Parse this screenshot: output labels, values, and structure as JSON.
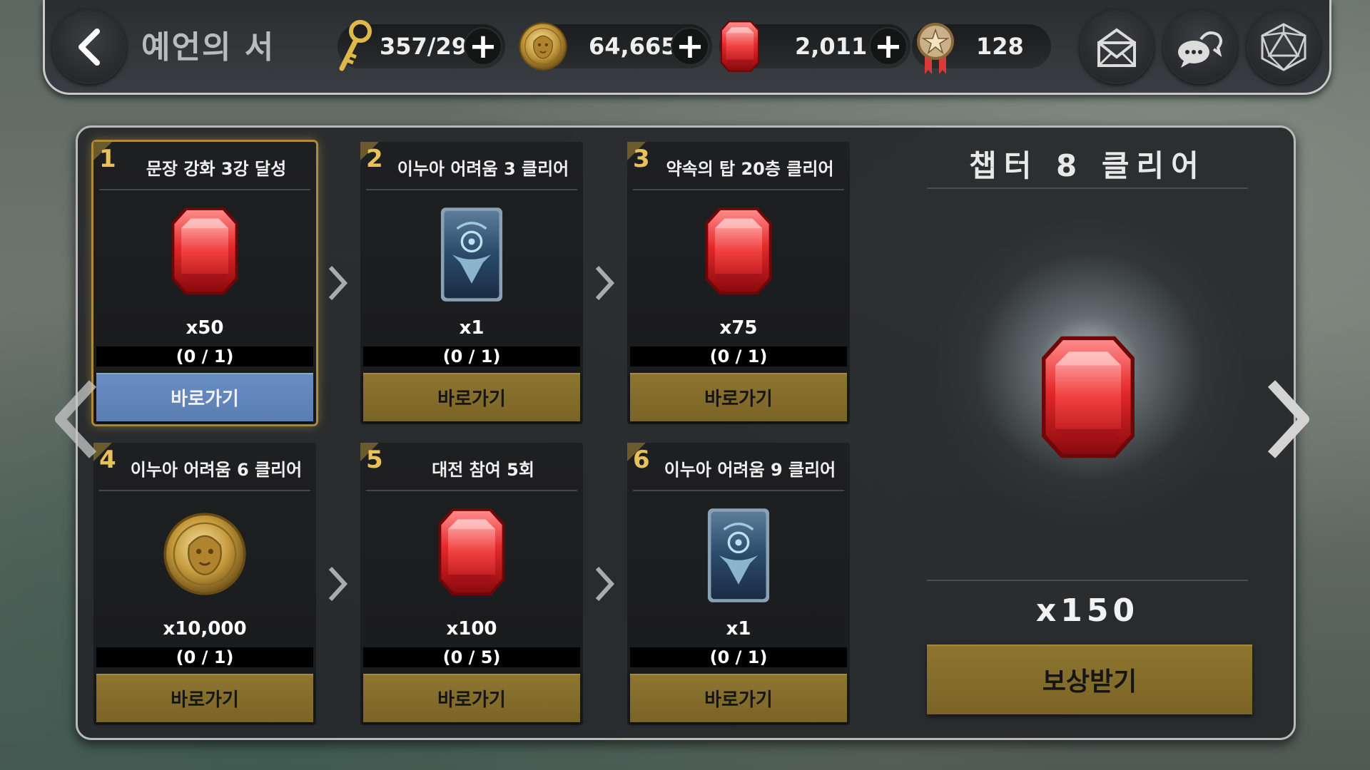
{
  "header": {
    "title": "예언의 서",
    "back_icon": "back-arrow-icon",
    "currencies": [
      {
        "name": "key",
        "icon": "key-icon",
        "value": "357/29",
        "has_plus": true
      },
      {
        "name": "gold",
        "icon": "lion-coin-icon",
        "value": "64,665",
        "has_plus": true
      },
      {
        "name": "ruby",
        "icon": "red-gem-icon",
        "value": "2,011",
        "has_plus": true
      },
      {
        "name": "medal",
        "icon": "medal-icon",
        "value": "128",
        "has_plus": false
      }
    ],
    "buttons": [
      {
        "name": "mail",
        "icon": "mail-icon"
      },
      {
        "name": "chat",
        "icon": "chat-icon"
      },
      {
        "name": "dice",
        "icon": "d20-icon"
      }
    ]
  },
  "missions": [
    {
      "num": "1",
      "title": "문장 강화 3강 달성",
      "reward_icon": "red-gem-icon",
      "qty": "x50",
      "progress": "(0 / 1)",
      "button": "바로가기",
      "active": true
    },
    {
      "num": "2",
      "title": "이누아 어려움 3 클리어",
      "reward_icon": "card-icon",
      "qty": "x1",
      "progress": "(0 / 1)",
      "button": "바로가기",
      "active": false
    },
    {
      "num": "3",
      "title": "약속의 탑 20층 클리어",
      "reward_icon": "red-gem-icon",
      "qty": "x75",
      "progress": "(0 / 1)",
      "button": "바로가기",
      "active": false
    },
    {
      "num": "4",
      "title": "이누아 어려움 6 클리어",
      "reward_icon": "lion-coin-icon",
      "qty": "x10,000",
      "progress": "(0 / 1)",
      "button": "바로가기",
      "active": false
    },
    {
      "num": "5",
      "title": "대전 참여 5회",
      "reward_icon": "red-gem-icon",
      "qty": "x100",
      "progress": "(0 / 5)",
      "button": "바로가기",
      "active": false
    },
    {
      "num": "6",
      "title": "이누아 어려움 9 클리어",
      "reward_icon": "card-icon",
      "qty": "x1",
      "progress": "(0 / 1)",
      "button": "바로가기",
      "active": false
    }
  ],
  "final_reward": {
    "title": "챕터 8 클리어",
    "reward_icon": "red-gem-icon",
    "qty": "x150",
    "button": "보상받기"
  },
  "colors": {
    "gold_button": "#8e7630",
    "active_button": "#6a8ec4",
    "number_gold": "#e8c15a",
    "gem_red": "#d92a2a"
  }
}
